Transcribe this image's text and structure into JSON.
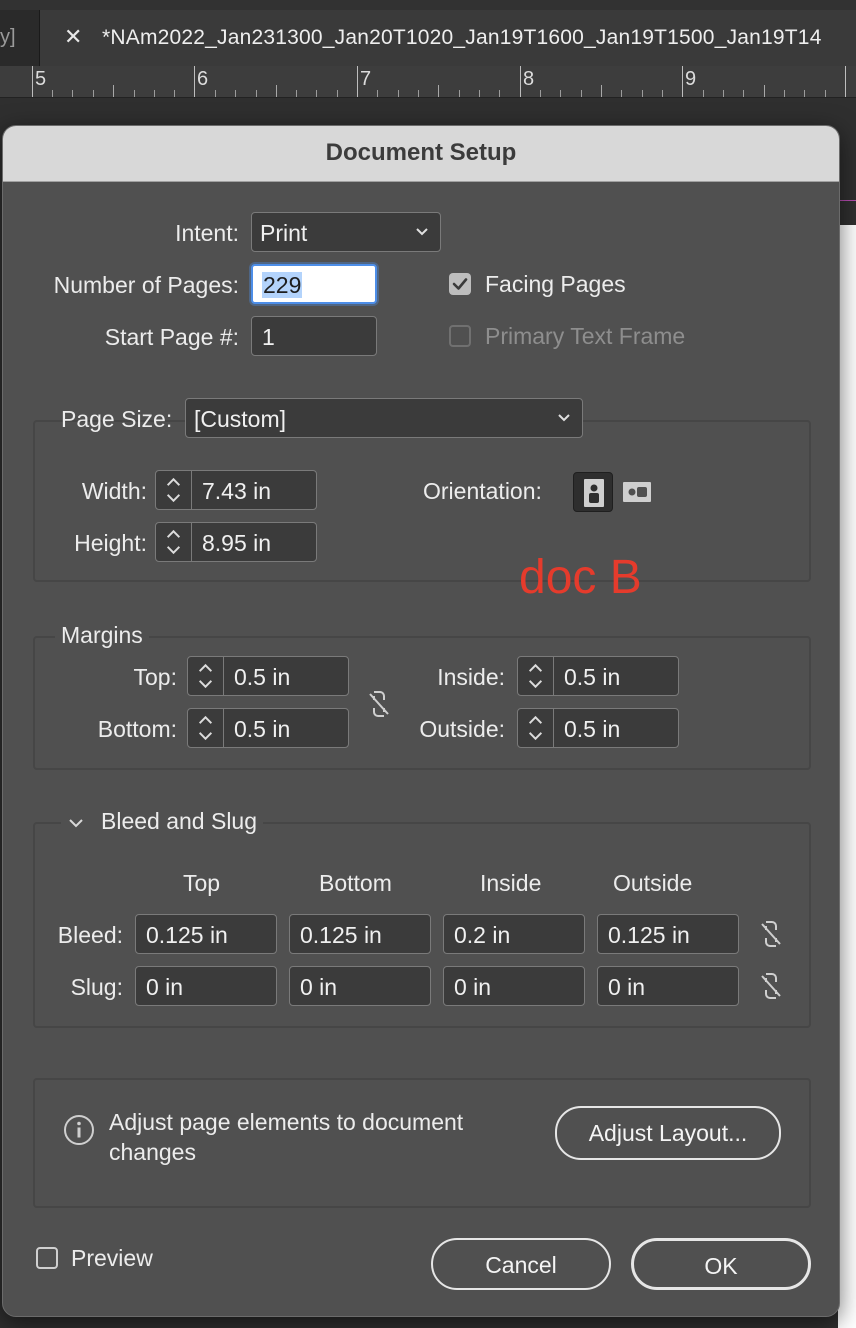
{
  "tabbar": {
    "prev_tab_fragment": "y]",
    "close_glyph": "✕",
    "active_tab_title": "*NAm2022_Jan231300_Jan20T1020_Jan19T1600_Jan19T1500_Jan19T14"
  },
  "ruler": {
    "numbers": [
      "5",
      "6",
      "7",
      "8",
      "9"
    ]
  },
  "dialog": {
    "title": "Document Setup",
    "intent": {
      "label": "Intent:",
      "value": "Print"
    },
    "pages": {
      "label": "Number of Pages:",
      "value": "229"
    },
    "start_page": {
      "label": "Start Page #:",
      "value": "1"
    },
    "facing_pages": {
      "label": "Facing Pages",
      "checked": true
    },
    "primary_text_frame": {
      "label": "Primary Text Frame",
      "checked": false,
      "enabled": false
    },
    "page_size": {
      "label": "Page Size:",
      "value": "[Custom]",
      "width_label": "Width:",
      "width": "7.43 in",
      "height_label": "Height:",
      "height": "8.95 in",
      "orientation_label": "Orientation:",
      "orientation": "portrait"
    },
    "annotation": "doc B",
    "margins": {
      "title": "Margins",
      "top_label": "Top:",
      "top": "0.5 in",
      "bottom_label": "Bottom:",
      "bottom": "0.5 in",
      "inside_label": "Inside:",
      "inside": "0.5 in",
      "outside_label": "Outside:",
      "outside": "0.5 in"
    },
    "bleed_slug": {
      "title": "Bleed and Slug",
      "columns": [
        "Top",
        "Bottom",
        "Inside",
        "Outside"
      ],
      "bleed_label": "Bleed:",
      "bleed": [
        "0.125 in",
        "0.125 in",
        "0.2 in",
        "0.125 in"
      ],
      "slug_label": "Slug:",
      "slug": [
        "0 in",
        "0 in",
        "0 in",
        "0 in"
      ]
    },
    "adjust": {
      "message_line1": "Adjust page elements to document",
      "message_line2": "changes",
      "button": "Adjust Layout..."
    },
    "preview": {
      "label": "Preview",
      "checked": false
    },
    "cancel_label": "Cancel",
    "ok_label": "OK"
  },
  "colors": {
    "accent": "#4d8ee8",
    "annotation": "#e53b2c",
    "dialog_bg": "#505050"
  }
}
